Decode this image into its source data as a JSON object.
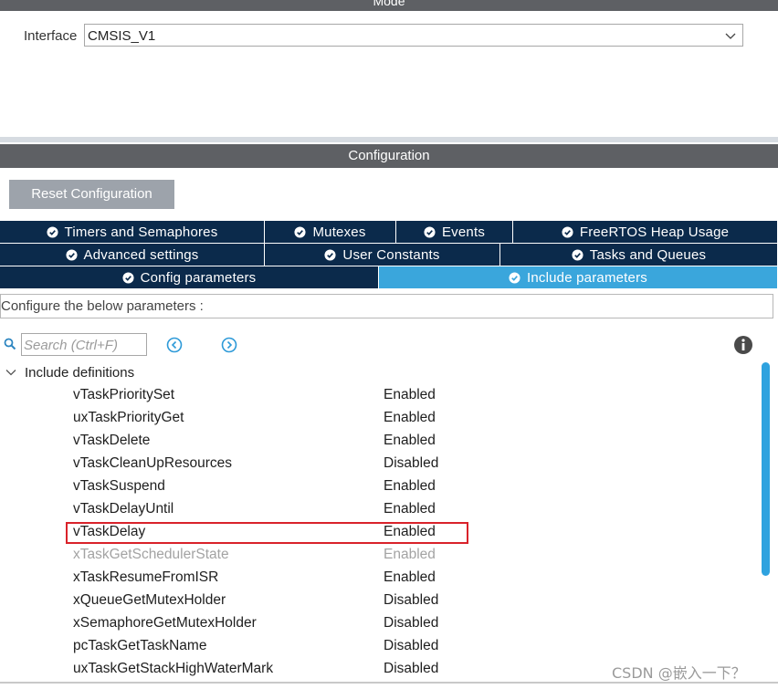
{
  "mode_title": "Mode",
  "interface": {
    "label": "Interface",
    "value": "CMSIS_V1"
  },
  "configuration_title": "Configuration",
  "reset_button": "Reset Configuration",
  "tabs": {
    "row1": [
      "Timers and Semaphores",
      "Mutexes",
      "Events",
      "FreeRTOS Heap Usage"
    ],
    "row2": [
      "Advanced settings",
      "User Constants",
      "Tasks and Queues"
    ],
    "row3": [
      "Config parameters",
      "Include parameters"
    ],
    "active": "Include parameters"
  },
  "configure_text": "Configure the below parameters :",
  "search": {
    "placeholder": "Search (Ctrl+F)"
  },
  "group": {
    "label": "Include definitions",
    "expanded": true
  },
  "parameters": [
    {
      "name": "vTaskPrioritySet",
      "value": "Enabled"
    },
    {
      "name": "uxTaskPriorityGet",
      "value": "Enabled"
    },
    {
      "name": "vTaskDelete",
      "value": "Enabled"
    },
    {
      "name": "vTaskCleanUpResources",
      "value": "Disabled"
    },
    {
      "name": "vTaskSuspend",
      "value": "Enabled"
    },
    {
      "name": "vTaskDelayUntil",
      "value": "Enabled"
    },
    {
      "name": "vTaskDelay",
      "value": "Enabled",
      "highlighted": true
    },
    {
      "name": "xTaskGetSchedulerState",
      "value": "Enabled",
      "disabled_look": true
    },
    {
      "name": "xTaskResumeFromISR",
      "value": "Enabled"
    },
    {
      "name": "xQueueGetMutexHolder",
      "value": "Disabled"
    },
    {
      "name": "xSemaphoreGetMutexHolder",
      "value": "Disabled"
    },
    {
      "name": "pcTaskGetTaskName",
      "value": "Disabled"
    },
    {
      "name": "uxTaskGetStackHighWaterMark",
      "value": "Disabled"
    }
  ],
  "watermark": "CSDN @嵌入一下？",
  "colors": {
    "tab_bg": "#0b2a4b",
    "tab_active": "#3aa6dc",
    "highlight_border": "#d9222a",
    "scrollbar": "#2ea2df"
  },
  "icons": [
    "chevron-down-icon",
    "check-circle-icon",
    "search-icon",
    "arrow-left-circle-icon",
    "arrow-right-circle-icon",
    "info-icon",
    "collapse-chevron-icon"
  ]
}
